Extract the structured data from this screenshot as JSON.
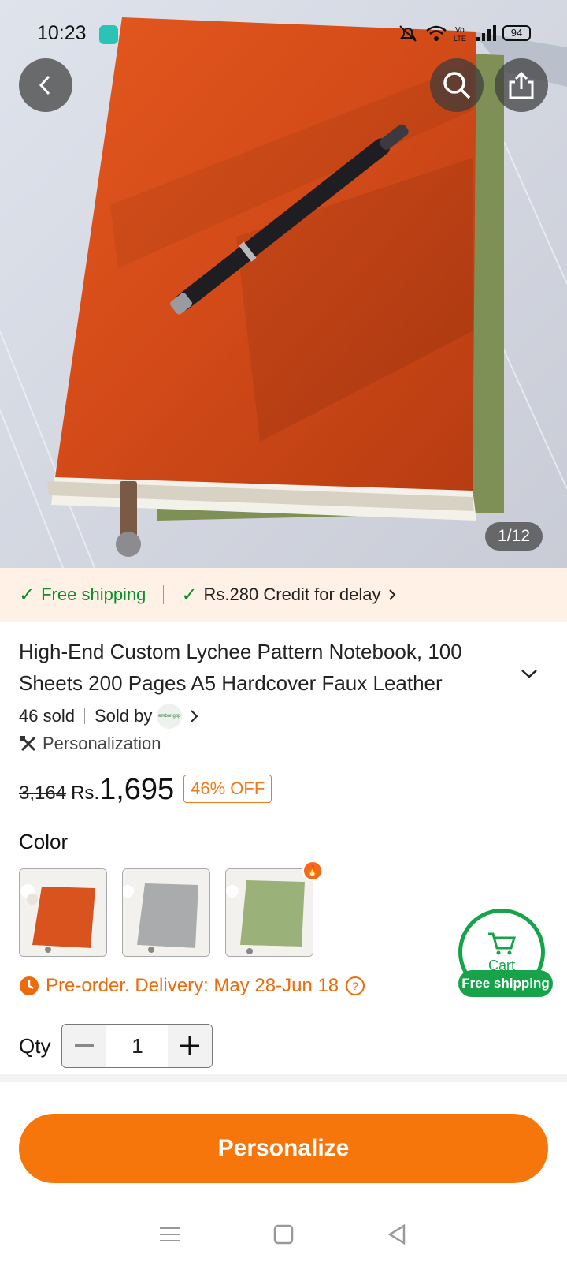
{
  "status_bar": {
    "time": "10:23",
    "battery": "94"
  },
  "gallery": {
    "counter": "1/12"
  },
  "shipping_strip": {
    "free_shipping": "Free shipping",
    "credit": "Rs.280 Credit for delay"
  },
  "product": {
    "title": "High-End Custom Lychee Pattern Notebook, 100 Sheets 200 Pages A5 Hardcover Faux Leather",
    "sold": "46 sold",
    "sold_by": "Sold by",
    "seller_logo_text": "embongop",
    "personalization": "Personalization"
  },
  "price": {
    "original": "3,164",
    "currency": "Rs.",
    "current": "1,695",
    "discount": "46% OFF"
  },
  "color": {
    "label": "Color",
    "options": [
      {
        "name": "orange",
        "hex": "#d9531f"
      },
      {
        "name": "gray",
        "hex": "#a9abad"
      },
      {
        "name": "green",
        "hex": "#9bb17a"
      }
    ]
  },
  "preorder": {
    "text": "Pre-order. Delivery: May 28-Jun 18"
  },
  "qty": {
    "label": "Qty",
    "value": "1"
  },
  "cart_float": {
    "label": "Cart",
    "badge": "Free shipping"
  },
  "cta": {
    "label": "Personalize"
  },
  "colors": {
    "accent": "#f7760b",
    "green": "#16a34a",
    "strip_bg": "#fff1e6"
  }
}
